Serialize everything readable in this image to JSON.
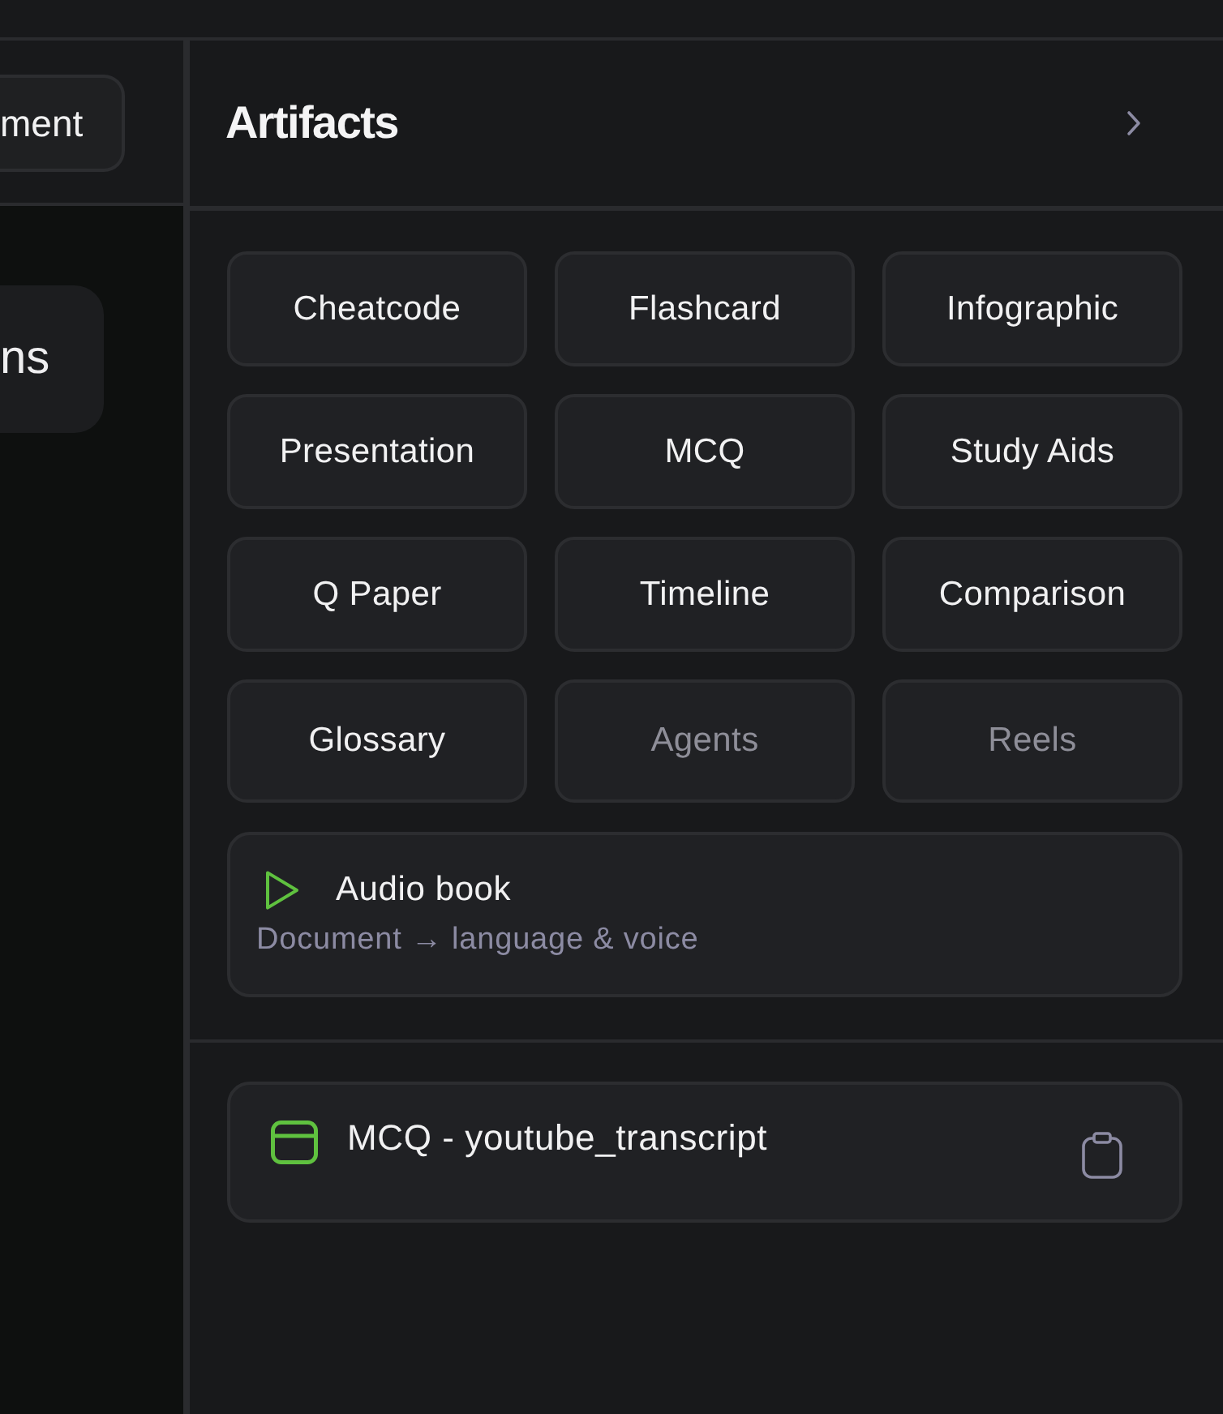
{
  "left_pane": {
    "header_button": {
      "label": "ment"
    },
    "message_bubble": {
      "text": "ns"
    }
  },
  "artifacts_panel": {
    "title": "Artifacts",
    "artifact_buttons": [
      {
        "label": "Cheatcode",
        "disabled": false
      },
      {
        "label": "Flashcard",
        "disabled": false
      },
      {
        "label": "Infographic",
        "disabled": false
      },
      {
        "label": "Presentation",
        "disabled": false
      },
      {
        "label": "MCQ",
        "disabled": false
      },
      {
        "label": "Study Aids",
        "disabled": false
      },
      {
        "label": "Q Paper",
        "disabled": false
      },
      {
        "label": "Timeline",
        "disabled": false
      },
      {
        "label": "Comparison",
        "disabled": false
      },
      {
        "label": "Glossary",
        "disabled": false
      },
      {
        "label": "Agents",
        "disabled": true
      },
      {
        "label": "Reels",
        "disabled": true
      }
    ],
    "audio_card": {
      "title": "Audio book",
      "subtitle": "Document → language & voice"
    },
    "saved_items": [
      {
        "title": "MCQ - youtube_transcript"
      }
    ]
  }
}
